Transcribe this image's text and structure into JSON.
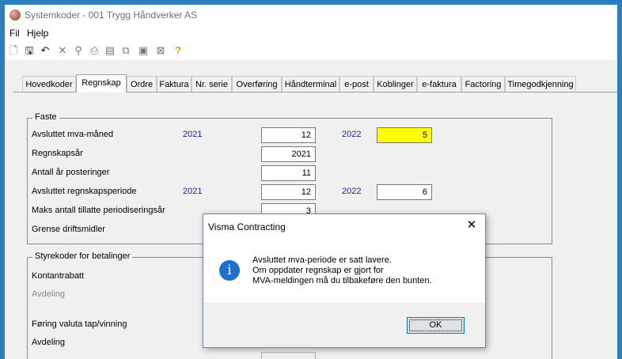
{
  "window": {
    "title": "Systemkoder - 001 Trygg Håndverker AS"
  },
  "menu": [
    "Fil",
    "Hjelp"
  ],
  "toolbar_icons": [
    "new-icon",
    "save-icon",
    "undo-icon",
    "delete-icon",
    "find-icon",
    "print-icon",
    "preview-icon",
    "copy-icon",
    "word-icon",
    "excel-icon",
    "help-icon"
  ],
  "tabs": [
    "Hovedkoder",
    "Regnskap",
    "Ordre",
    "Faktura",
    "Nr. serie",
    "Overføring",
    "Håndterminal",
    "e-post",
    "Koblinger",
    "e-faktura",
    "Factoring",
    "Timegodkjenning"
  ],
  "active_tab": "Regnskap",
  "faste": {
    "title": "Faste",
    "rows": [
      {
        "label": "Avsluttet mva-måned",
        "year1": "2021",
        "value1": "12",
        "year2": "2022",
        "value2": "5"
      },
      {
        "label": "Regnskapsår",
        "value1": "2021"
      },
      {
        "label": "Antall år posteringer",
        "value1": "11"
      },
      {
        "label": "Avsluttet regnskapsperiode",
        "year1": "2021",
        "value1": "12",
        "year2": "2022",
        "value2": "6"
      },
      {
        "label": "Maks antall tillatte periodiseringsår",
        "value1": "3"
      },
      {
        "label": "Grense driftsmidler"
      }
    ]
  },
  "styrekoder": {
    "title": "Styrekoder for betalinger",
    "rows": [
      {
        "label": "Kontantrabatt"
      },
      {
        "label": "Avdeling"
      },
      {
        "label": "Føring valuta tap/vinning"
      },
      {
        "label": "Avdeling"
      }
    ]
  },
  "dialog": {
    "title": "Visma Contracting",
    "message_lines": [
      "Avsluttet mva-periode er satt lavere.",
      "Om oppdater regnskap er gjort for",
      "MVA-meldingen må du tilbakeføre den bunten."
    ],
    "ok_label": "OK"
  },
  "colors": {
    "highlight": "#ffff00",
    "accent": "#1f6fd0",
    "desktop": "#2c7fbf"
  }
}
